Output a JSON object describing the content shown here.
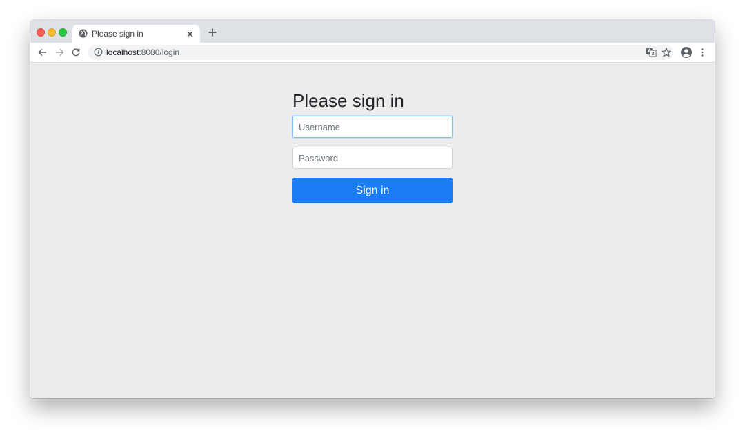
{
  "browser": {
    "tab": {
      "title": "Please sign in"
    },
    "address_bar": {
      "host": "localhost",
      "path": ":8080/login"
    }
  },
  "page": {
    "heading": "Please sign in",
    "username": {
      "placeholder": "Username",
      "value": ""
    },
    "password": {
      "placeholder": "Password",
      "value": ""
    },
    "submit_label": "Sign in"
  },
  "colors": {
    "primary_button": "#1a7cf5",
    "page_background": "#ececec",
    "focus_border": "#80bdff"
  },
  "icons": {
    "favicon": "globe-icon",
    "tab_close": "close-icon",
    "new_tab": "plus-icon",
    "back": "arrow-left-icon",
    "forward": "arrow-right-icon",
    "reload": "reload-icon",
    "site_info": "info-icon",
    "translate": "translate-icon",
    "bookmark": "star-icon",
    "profile": "profile-icon",
    "menu": "kebab-menu-icon"
  }
}
